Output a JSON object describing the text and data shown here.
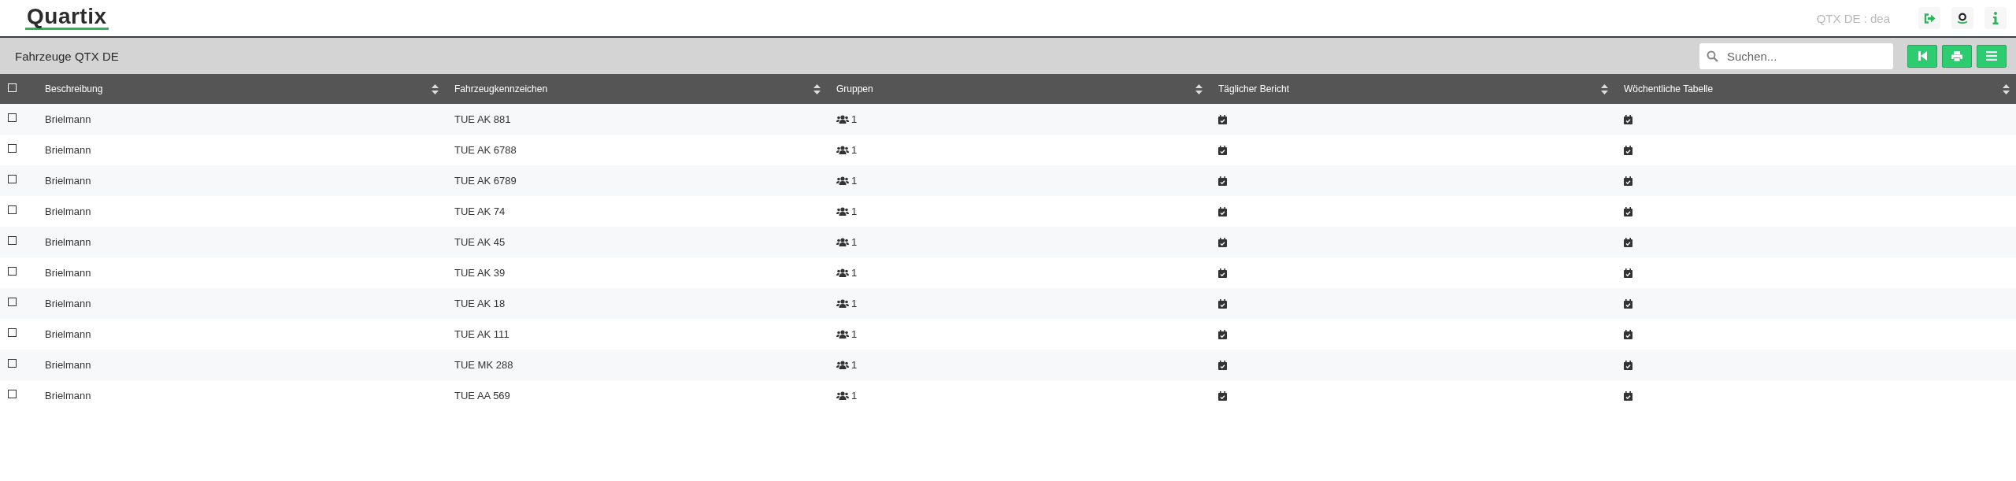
{
  "header": {
    "logo": "Quartix",
    "account": "QTX DE : dea"
  },
  "toolbar": {
    "title": "Fahrzeuge QTX DE",
    "search": {
      "placeholder": "Suchen..."
    }
  },
  "table": {
    "select_all": {
      "checked": false
    },
    "columns": [
      "Beschreibung",
      "Fahrzeugkennzeichen",
      "Gruppen",
      "Täglicher Bericht",
      "Wöchentliche Tabelle"
    ],
    "rows": [
      {
        "checked": false,
        "description": "Brielmann",
        "plate": "TUE AK 881",
        "groups": "1"
      },
      {
        "checked": false,
        "description": "Brielmann",
        "plate": "TUE AK 6788",
        "groups": "1"
      },
      {
        "checked": false,
        "description": "Brielmann",
        "plate": "TUE AK 6789",
        "groups": "1"
      },
      {
        "checked": false,
        "description": "Brielmann",
        "plate": "TUE AK 74",
        "groups": "1"
      },
      {
        "checked": false,
        "description": "Brielmann",
        "plate": "TUE AK 45",
        "groups": "1"
      },
      {
        "checked": false,
        "description": "Brielmann",
        "plate": "TUE AK 39",
        "groups": "1"
      },
      {
        "checked": false,
        "description": "Brielmann",
        "plate": "TUE AK 18",
        "groups": "1"
      },
      {
        "checked": false,
        "description": "Brielmann",
        "plate": "TUE AK 111",
        "groups": "1"
      },
      {
        "checked": false,
        "description": "Brielmann",
        "plate": "TUE MK 288",
        "groups": "1"
      },
      {
        "checked": false,
        "description": "Brielmann",
        "plate": "TUE AA 569",
        "groups": "1"
      }
    ]
  }
}
